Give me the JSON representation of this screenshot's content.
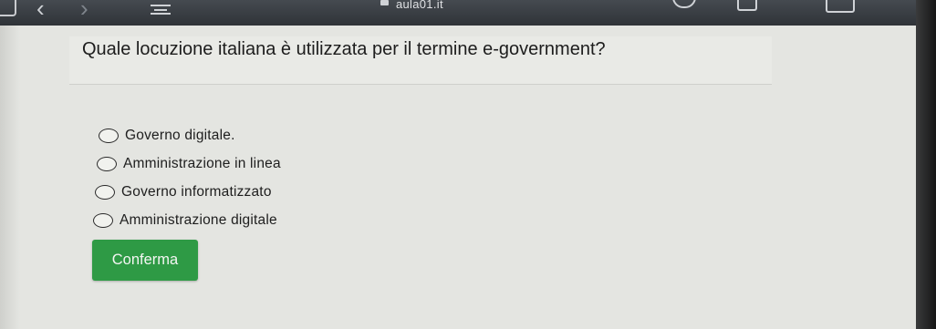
{
  "browser": {
    "url": "aula01.it",
    "icons": {
      "sidebar": "sidebar-icon",
      "back": "chevron-left-icon",
      "forward": "chevron-right-icon",
      "reader": "reader-icon",
      "lock": "lock-icon",
      "reload": "reload-icon",
      "share": "share-icon",
      "tabs": "tabs-icon"
    },
    "back_glyph": "‹",
    "forward_glyph": "›"
  },
  "quiz": {
    "question": "Quale locuzione italiana è utilizzata per il termine e-government?",
    "options": [
      {
        "label": "Governo digitale."
      },
      {
        "label": "Amministrazione in linea"
      },
      {
        "label": "Governo informatizzato"
      },
      {
        "label": "Amministrazione digitale"
      }
    ],
    "confirm_label": "Conferma"
  },
  "colors": {
    "confirm_button": "#2e9a45",
    "page_background": "#e4e5e1",
    "toolbar": "#3a3f44"
  }
}
